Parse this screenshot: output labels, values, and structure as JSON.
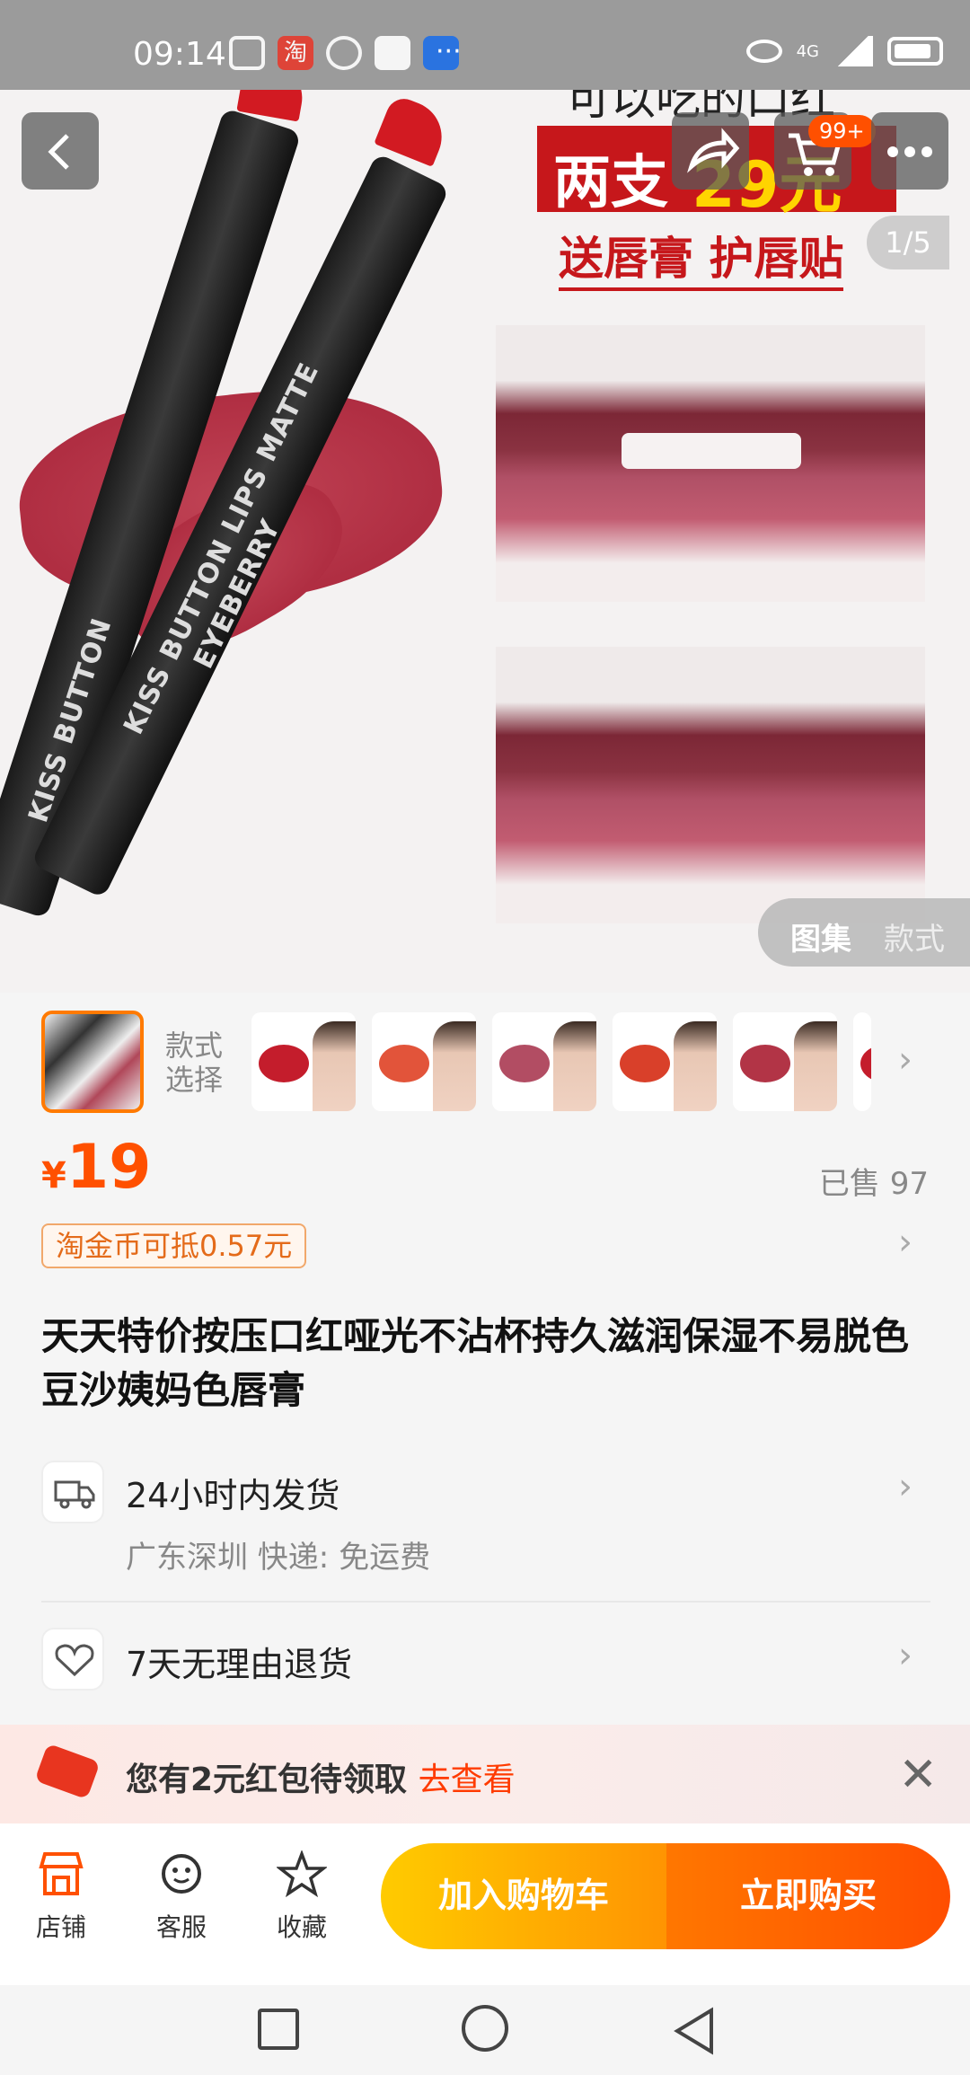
{
  "status_bar": {
    "time": "09:14",
    "taobao_glyph": "淘",
    "dots": "···",
    "network": "4G"
  },
  "hero": {
    "promo_title": "可以吃的口红",
    "promo_line_a": "两支",
    "promo_line_b": "29元",
    "promo_sub": "送唇膏 护唇贴",
    "counter": "1/5",
    "cart_badge": "99+",
    "lipstick_text_a": "KISS BUTTON LIPS MATTE",
    "lipstick_text_b": "EYEBERRY",
    "lipstick_text_c": "KISS BUTTON",
    "lipstick_letter": "E",
    "gallery_tabs": [
      "图集",
      "款式"
    ]
  },
  "variants": {
    "label": "款式\n选择",
    "label_line1": "款式",
    "label_line2": "选择"
  },
  "price": {
    "symbol": "¥",
    "value": "19",
    "sold": "已售 97",
    "coin": "淘金币可抵0.57元"
  },
  "product": {
    "title": "天天特价按压口红哑光不沾杯持久滋润保湿不易脱色豆沙姨妈色唇膏"
  },
  "services": {
    "shipping": "24小时内发货",
    "shipping_sub": "广东深圳  快递: 免运费",
    "returns": "7天无理由退货"
  },
  "coupon": {
    "text": "您有2元红包待领取",
    "link": "去查看"
  },
  "bottom_bar": {
    "shop": "店铺",
    "service": "客服",
    "favorite": "收藏",
    "add_cart": "加入购物车",
    "buy_now": "立即购买"
  },
  "colors": {
    "accent": "#ff5000",
    "brand_red": "#c6171b",
    "cart_btn": "#ffb000"
  },
  "icons": [
    "back-arrow-icon",
    "share-icon",
    "cart-icon",
    "more-icon",
    "truck-icon",
    "return-icon",
    "shop-icon",
    "service-icon",
    "star-icon",
    "close-icon",
    "chevron-right-icon"
  ]
}
